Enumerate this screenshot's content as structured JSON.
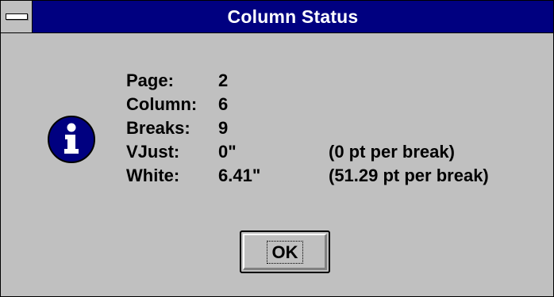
{
  "window": {
    "title": "Column Status",
    "system_menu_icon": "system-menu-icon"
  },
  "icon": {
    "name": "info-icon",
    "glyph": "i",
    "color": "#000080"
  },
  "status": {
    "rows": [
      {
        "label": "Page:",
        "value": "2",
        "note": ""
      },
      {
        "label": "Column:",
        "value": "6",
        "note": ""
      },
      {
        "label": "Breaks:",
        "value": "9",
        "note": ""
      },
      {
        "label": "VJust:",
        "value": "0\"",
        "note": "(0 pt per break)"
      },
      {
        "label": "White:",
        "value": "6.41\"",
        "note": "(51.29 pt per break)"
      }
    ]
  },
  "buttons": {
    "ok_label": "OK"
  },
  "colors": {
    "titlebar": "#000080",
    "dialog_face": "#c0c0c0"
  }
}
